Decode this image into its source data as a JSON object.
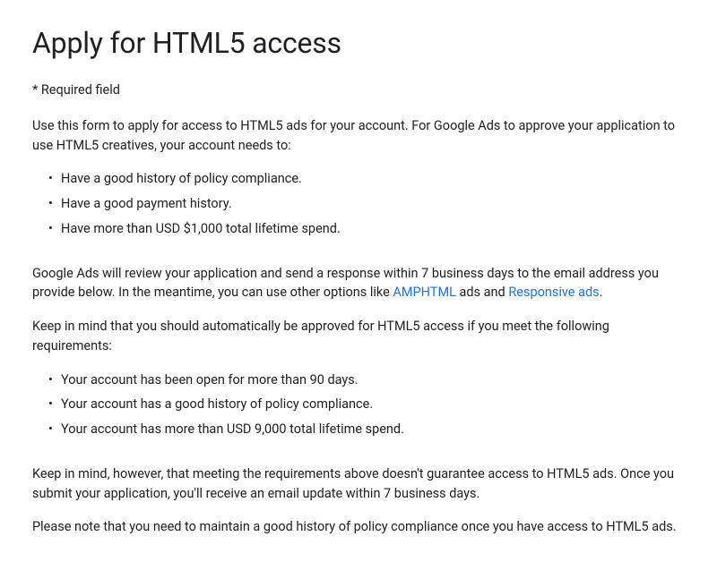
{
  "title": "Apply for HTML5 access",
  "required_note": "* Required field",
  "intro_para": "Use this form to apply for access to HTML5 ads for your account. For Google Ads to approve your application to use HTML5 creatives, your account needs to:",
  "list1": {
    "item0": "Have a good history of policy compliance.",
    "item1": "Have a good payment history.",
    "item2": "Have more than USD $1,000 total lifetime spend."
  },
  "review_para": {
    "part1": "Google Ads will review your application and send a response within 7 business days to the email address you provide below. In the meantime, you can use other options like ",
    "link1": "AMPHTML",
    "part2": " ads and ",
    "link2": "Responsive ads",
    "part3": "."
  },
  "auto_approve_para": "Keep in mind that you should automatically be approved for HTML5 access if you meet the following requirements:",
  "list2": {
    "item0": "Your account has been open for more than 90 days.",
    "item1": "Your account has a good history of policy compliance.",
    "item2": "Your account has more than USD 9,000 total lifetime spend."
  },
  "caveat_para": "Keep in mind, however, that meeting the requirements above doesn't guarantee access to HTML5 ads. Once you submit your application, you'll receive an email update within 7 business days.",
  "maintain_para": "Please note that you need to maintain a good history of policy compliance once you have access to HTML5 ads."
}
